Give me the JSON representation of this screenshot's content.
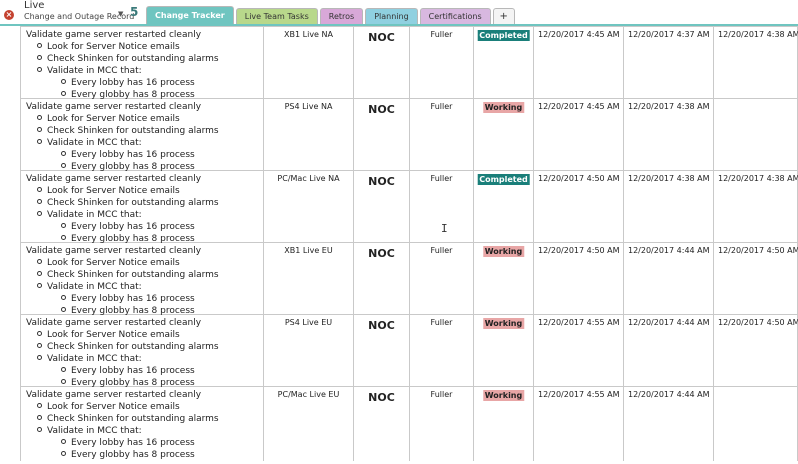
{
  "notebook": {
    "name": "Live",
    "section_group": "Change and Outage Record",
    "back_number": "5"
  },
  "tabs": [
    {
      "label": "Change Tracker",
      "color": "#6fc5c0",
      "active": true
    },
    {
      "label": "Live Team Tasks",
      "color": "#b8d88b",
      "active": false
    },
    {
      "label": "Retros",
      "color": "#d8a8d8",
      "active": false
    },
    {
      "label": "Planning",
      "color": "#8fd0e0",
      "active": false
    },
    {
      "label": "Certifications",
      "color": "#d8b8e0",
      "active": false
    },
    {
      "label": "+",
      "color": "#f4f4f4",
      "active": false
    }
  ],
  "colors": {
    "completed": "#1a7f7a",
    "working": "#e8a6a6",
    "tabline": "#6fc5c0"
  },
  "rows": [
    {
      "task": "Validate game server restarted cleanly",
      "subtasks": [
        "Look for Server Notice emails",
        "Check Shinken for outstanding alarms",
        "Validate in MCC that:"
      ],
      "subsubtasks": [
        "Every lobby has 16 process",
        "Every globby has 8 process"
      ],
      "platform": "XB1 Live NA",
      "team": "NOC",
      "owner": "Fuller",
      "status": "Completed",
      "status_type": "completed",
      "t1": "12/20/2017 4:45 AM",
      "t2": "12/20/2017 4:37 AM",
      "t3": "12/20/2017 4:38 AM"
    },
    {
      "task": "Validate game server restarted cleanly",
      "subtasks": [
        "Look for Server Notice emails",
        "Check Shinken for outstanding alarms",
        "Validate in MCC that:"
      ],
      "subsubtasks": [
        "Every lobby has 16 process",
        "Every globby has 8 process"
      ],
      "platform": "PS4 Live NA",
      "team": "NOC",
      "owner": "Fuller",
      "status": "Working",
      "status_type": "working",
      "t1": "12/20/2017 4:45 AM",
      "t2": "12/20/2017 4:38 AM",
      "t3": ""
    },
    {
      "task": "Validate game server restarted cleanly",
      "subtasks": [
        "Look for Server Notice emails",
        "Check Shinken for outstanding alarms",
        "Validate in MCC that:"
      ],
      "subsubtasks": [
        "Every lobby has 16 process",
        "Every globby has 8 process"
      ],
      "platform": "PC/Mac Live NA",
      "team": "NOC",
      "owner": "Fuller",
      "status": "Completed",
      "status_type": "completed",
      "t1": "12/20/2017 4:50 AM",
      "t2": "12/20/2017 4:38 AM",
      "t3": "12/20/2017 4:38 AM"
    },
    {
      "task": "Validate game server restarted cleanly",
      "subtasks": [
        "Look for Server Notice emails",
        "Check Shinken for outstanding alarms",
        "Validate in MCC that:"
      ],
      "subsubtasks": [
        "Every lobby has 16 process",
        "Every globby has 8 process"
      ],
      "platform": "XB1 Live EU",
      "team": "NOC",
      "owner": "Fuller",
      "status": "Working",
      "status_type": "working",
      "t1": "12/20/2017 4:50 AM",
      "t2": "12/20/2017 4:44 AM",
      "t3": "12/20/2017 4:50 AM"
    },
    {
      "task": "Validate game server restarted cleanly",
      "subtasks": [
        "Look for Server Notice emails",
        "Check Shinken for outstanding alarms",
        "Validate in MCC that:"
      ],
      "subsubtasks": [
        "Every lobby has 16 process",
        "Every globby has 8 process"
      ],
      "platform": "PS4 Live EU",
      "team": "NOC",
      "owner": "Fuller",
      "status": "Working",
      "status_type": "working",
      "t1": "12/20/2017 4:55 AM",
      "t2": "12/20/2017 4:44 AM",
      "t3": "12/20/2017 4:50 AM"
    },
    {
      "task": "Validate game server restarted cleanly",
      "subtasks": [
        "Look for Server Notice emails",
        "Check Shinken for outstanding alarms",
        "Validate in MCC that:"
      ],
      "subsubtasks": [
        "Every lobby has 16 process",
        "Every globby has 8 process"
      ],
      "platform": "PC/Mac Live EU",
      "team": "NOC",
      "owner": "Fuller",
      "status": "Working",
      "status_type": "working",
      "t1": "12/20/2017 4:55 AM",
      "t2": "12/20/2017 4:44 AM",
      "t3": ""
    }
  ]
}
